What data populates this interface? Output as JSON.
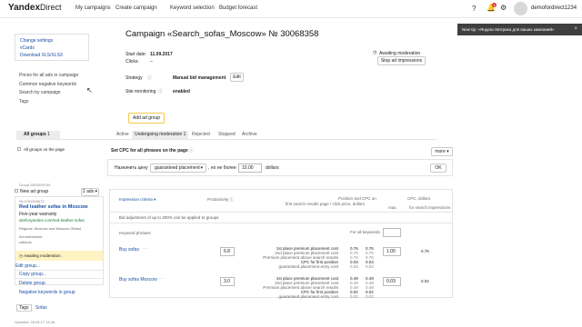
{
  "header": {
    "logo_yandex": "Yandex",
    "logo_direct": "Direct",
    "nav": [
      "My campaigns",
      "Create campaign",
      "Keyword selection",
      "Budget forecast"
    ],
    "notifications_count": "1",
    "username": "demofordirect1234"
  },
  "toast": {
    "text": "New tip: «Яндекс.Метрика для ваших кампаний»",
    "close": "×"
  },
  "sidebar": {
    "links": [
      "Change settings",
      "vCards",
      "Download XLS/XLSX"
    ],
    "items": [
      "Prices for all ads in campaign",
      "Common negative keywords",
      "Search by campaign",
      "Tags"
    ]
  },
  "campaign": {
    "title": "Campaign «Search_sofas_Moscow» № 30068358",
    "start_label": "Start date:",
    "start_value": "11.09.2017",
    "clicks_label": "Clicks:",
    "clicks_value": "–",
    "status": "Awaiting moderation",
    "stop_button": "Stop ad impressions",
    "strategy_label": "Strategy",
    "strategy_value": "Manual bid management",
    "edit_button": "Edit",
    "monitoring_label": "Site monitoring",
    "monitoring_value": "enabled",
    "add_group_button": "Add ad group"
  },
  "tabs": {
    "all_groups": "All groups",
    "all_groups_count": "1",
    "items": [
      "Active",
      "Undergoing moderation",
      "Rejected",
      "Stopped",
      "Archive"
    ],
    "undergoing_count": "1"
  },
  "filters": {
    "all_groups_on_page": "All groups on the page",
    "set_cpc_title": "Set CPC for all phrases on the page",
    "more_button": "more",
    "assign_label": "Назначить цену",
    "placement_select": "guaranteed placement",
    "no_more_than": ", но не более",
    "price_value": "10.00",
    "currency": "dollars",
    "ok_button": "OK"
  },
  "group": {
    "group_label": "Group 2803559766",
    "new_group": "New ad group",
    "ads_count": "2 ads",
    "ad_id": "№ 4781555672",
    "ad_title": "Red leather sofas in Moscow",
    "ad_text": "Five-year warranty",
    "ad_url": "siteforyandex.com/red-leather-sofas",
    "region": "Regions: Moscow and Moscow Oblast",
    "extensions_label": "Ad extensions:",
    "extensions_value": "callouts",
    "moderation": "Awaiting moderation.",
    "actions": [
      "Edit group...",
      "Copy group...",
      "Delete group",
      "Negative keywords in group"
    ],
    "tags_label": "Tags",
    "tags_value": "Sofas",
    "updated": "Updated: 28.09.17 14:38"
  },
  "table": {
    "col_criteria": "Impression criteria",
    "col_productivity": "Productivity",
    "col_position": "Position and CPC on",
    "col_position2": "first search results page / click price, dollars",
    "col_cpc": "CPC, dollars",
    "col_cpc_for_search": "for search impressions",
    "col_max": "max.",
    "bid_note": "Bid adjustment of up to 200% can be applied to groups",
    "keyword_phrases": "Keyword phrases",
    "for_all_keywords": "For all keywords",
    "rows": [
      {
        "phrase": "Buy sofas",
        "productivity": "6.8",
        "labels": [
          "1st place premium placement cost",
          "2nd place premium placement cost",
          "Premium placement above search results",
          "CPC for first position",
          "guaranteed placement entry cost"
        ],
        "vals1": [
          "0.76",
          "0.76",
          "0.76",
          "0.03",
          "0.03"
        ],
        "vals2": [
          "0.76",
          "0.76",
          "0.76",
          "0.03",
          "0.03"
        ],
        "max_bid": "1.00",
        "search_cpc": "0.76"
      },
      {
        "phrase": "Buy sofas Moscow",
        "productivity": "3.0",
        "labels": [
          "1st place premium placement cost",
          "2nd place premium placement cost",
          "Premium placement above search results",
          "CPC for first position",
          "guaranteed placement entry cost"
        ],
        "vals1": [
          "0.49",
          "0.49",
          "0.49",
          "0.02",
          "0.02"
        ],
        "vals2": [
          "0.49",
          "0.49",
          "0.49",
          "0.02",
          "0.02"
        ],
        "max_bid": "0.03",
        "search_cpc": "0.02"
      }
    ]
  },
  "colors": {
    "link": "#1a4fa3",
    "badge": "#e03c2e",
    "toast_bg": "#3f3f3f",
    "warning_bg": "#fff3c4",
    "add_group_border": "#f2c94c"
  }
}
